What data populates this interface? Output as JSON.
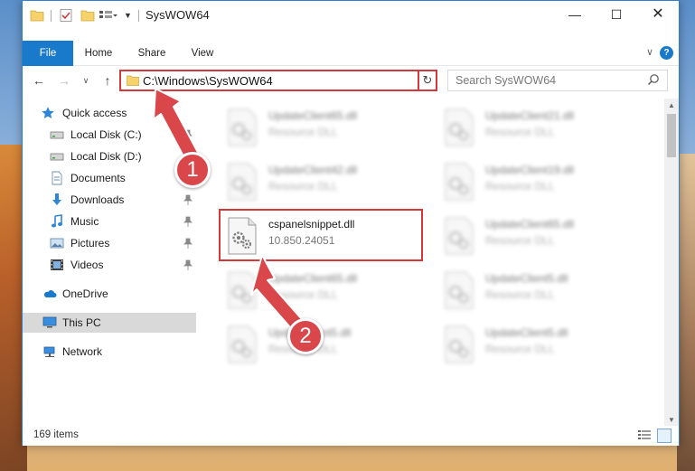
{
  "window": {
    "title": "SysWOW64",
    "controls": {
      "minimize": "—",
      "maximize": "☐",
      "close": "✕"
    }
  },
  "ribbon": {
    "tabs": [
      "File",
      "Home",
      "Share",
      "View"
    ],
    "help": "?"
  },
  "address": {
    "path": "C:\\Windows\\SysWOW64",
    "search_placeholder": "Search SysWOW64"
  },
  "sidebar": {
    "items": [
      {
        "label": "Quick access",
        "icon": "star-icon",
        "pinned": false
      },
      {
        "label": "Local Disk (C:)",
        "icon": "drive-icon",
        "pinned": true
      },
      {
        "label": "Local Disk (D:)",
        "icon": "drive-icon",
        "pinned": false
      },
      {
        "label": "Documents",
        "icon": "documents-icon",
        "pinned": true
      },
      {
        "label": "Downloads",
        "icon": "download-icon",
        "pinned": true
      },
      {
        "label": "Music",
        "icon": "music-icon",
        "pinned": true
      },
      {
        "label": "Pictures",
        "icon": "pictures-icon",
        "pinned": true
      },
      {
        "label": "Videos",
        "icon": "videos-icon",
        "pinned": true
      },
      {
        "label": "OneDrive",
        "icon": "onedrive-icon",
        "pinned": false
      },
      {
        "label": "This PC",
        "icon": "computer-icon",
        "pinned": false,
        "selected": true
      },
      {
        "label": "Network",
        "icon": "network-icon",
        "pinned": false
      }
    ]
  },
  "files": [
    {
      "name": "UpdateClient65.dll",
      "sub": "Resource DLL",
      "blurred": true
    },
    {
      "name": "UpdateClient21.dll",
      "sub": "Resource DLL",
      "blurred": true
    },
    {
      "name": "UpdateClient42.dll",
      "sub": "Resource DLL",
      "blurred": true
    },
    {
      "name": "UpdateClient19.dll",
      "sub": "Resource DLL",
      "blurred": true
    },
    {
      "name": "cspanelsnippet.dll",
      "sub": "10.850.24051",
      "blurred": false
    },
    {
      "name": "UpdateClient65.dll",
      "sub": "Resource DLL",
      "blurred": true
    },
    {
      "name": "UpdateClient65.dll",
      "sub": "Resource DLL",
      "blurred": true
    },
    {
      "name": "UpdateClient5.dll",
      "sub": "Resource DLL",
      "blurred": true
    },
    {
      "name": "UpdateClient5.dll",
      "sub": "Resource DLL",
      "blurred": true
    },
    {
      "name": "UpdateClient5.dll",
      "sub": "Resource DLL",
      "blurred": true
    }
  ],
  "status": {
    "count": "169 items"
  },
  "annotations": {
    "step1": "1",
    "step2": "2",
    "color": "#d9474b"
  }
}
